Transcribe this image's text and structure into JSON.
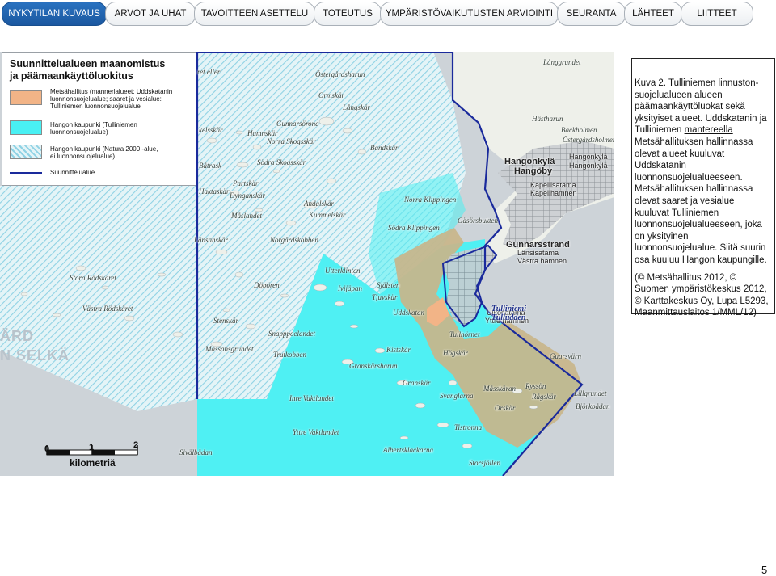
{
  "nav": {
    "tabs": [
      {
        "label": "NYKYTILAN KUVAUS",
        "active": true
      },
      {
        "label": "ARVOT JA UHAT",
        "active": false
      },
      {
        "label": "TAVOITTEEN ASETTELU",
        "active": false
      },
      {
        "label": "TOTEUTUS",
        "active": false
      },
      {
        "label": "YMPÄRISTÖVAIKUTUSTEN ARVIOINTI",
        "active": false
      },
      {
        "label": "SEURANTA",
        "active": false
      },
      {
        "label": "LÄHTEET",
        "active": false
      },
      {
        "label": "LIITTEET",
        "active": false
      }
    ],
    "active_color": "#1f5fa8"
  },
  "legend": {
    "title_line1": "Suunnittelualueen maanomistus",
    "title_line2": "ja päämaankäyttöluokitus",
    "items": [
      {
        "swatch": "tan",
        "color": "#f2b487",
        "lines": [
          "Metsähallitus (mannerlalueet: Uddskatanin",
          "luonnonsuojelualue; saaret ja vesialue:",
          "Tulliniemen luonnonsuojelualue"
        ]
      },
      {
        "swatch": "cyan",
        "color": "#49f0f3",
        "lines": [
          "Hangon kaupunki (Tulliniemen",
          "luonnonsuojelualue)"
        ]
      },
      {
        "swatch": "hatch",
        "color": "#bfeaf0",
        "lines": [
          "Hangon kaupunki (Natura 2000 -alue,",
          "ei luonnonsuojelualue)"
        ]
      },
      {
        "swatch": "line",
        "color": "#1a2a9c",
        "lines": [
          "Suunnittelualue"
        ]
      }
    ]
  },
  "map": {
    "colors": {
      "water": "#c9d0d6",
      "land": "#eef0ea",
      "hatch": "#9fd8e8",
      "cyan": "#49f0f3",
      "tan": "#c9b58a",
      "boundary": "#1a2a9c",
      "town": "#b9bec4"
    },
    "labels": [
      "Långgrundet",
      "Östergårdsharun",
      "Ormskär",
      "Långskär",
      "Gunnarsörona",
      "Hamnskär",
      "Norra Skogsskär",
      "Södra Skogsskär",
      "Bandskär",
      "Partskär",
      "Dynganskär",
      "Andalskär",
      "Kummelskär",
      "Måslandet",
      "Norra Klippingen",
      "Gäsörsbukten",
      "Södra Klippingen",
      "Länsanskär",
      "Norgårdskobben",
      "Utterklinten",
      "Själsten",
      "Ivijäpan",
      "Tjuvskär",
      "Uddskatan",
      "Döbören",
      "Stenskär",
      "Snapppoelandet",
      "Massansgrundet",
      "Trutkobben",
      "Kistskär",
      "Högskär",
      "Granskärsharun",
      "Granskär",
      "Svanglarna",
      "Måsskäran",
      "Ryssön",
      "Rågskär",
      "Orskär",
      "Tistronna",
      "Inre Vaktlandet",
      "Yttre Vaktlandet",
      "Albertsklackarna",
      "Sivälbådan",
      "Storsjöllen",
      "Guarsvärn",
      "Lillgrundet",
      "Björkbådan",
      "Hästharun",
      "Backholmen",
      "Östergårdsholmen",
      "Hangonkylä",
      "Hangonkylä",
      "Ulkosatama",
      "Yttre hamnen",
      "Kapellisatama",
      "Kapellhamnen",
      "Länsisatama",
      "Västra hamnen",
      "Stora Rödskäret",
      "Västra Rödskäret",
      "kelsskär",
      "Båtrask",
      "Haktaskär",
      "ret eller",
      "Hangonkylä",
      "Hangöby",
      "Gunnarsstrand",
      "Tulliniemi",
      "Tulludden",
      "Tullhörnet",
      "ÄRD",
      "N SELKÄ"
    ]
  },
  "scale": {
    "ticks": [
      "0",
      "1",
      "2"
    ],
    "unit": "kilometriä"
  },
  "caption": {
    "paragraph_parts": [
      "Kuva 2. Tulliniemen linnuston-suojelualueen alueen päämaankäyttöluokat sekä yksityiset alueet. Uddskatanin ja Tulliniemen ",
      "mantereella",
      " Metsähallituksen hallinnassa olevat alueet kuuluvat Uddskatanin luonnonsuojelualueeseen. Metsähallituksen hallinnassa olevat saaret ja vesialue kuuluvat Tulliniemen luonnonsuojelualueeseen, joka on yksityinen luonnonsuojelualue. Siitä suurin osa kuuluu Hangon kaupungille."
    ],
    "credits": "(© Metsähallitus 2012, © Suomen ympäristökeskus 2012, © Karttakeskus Oy, Lupa L5293, Maanmittauslaitos 1/MML/12)"
  },
  "page_number": "5"
}
